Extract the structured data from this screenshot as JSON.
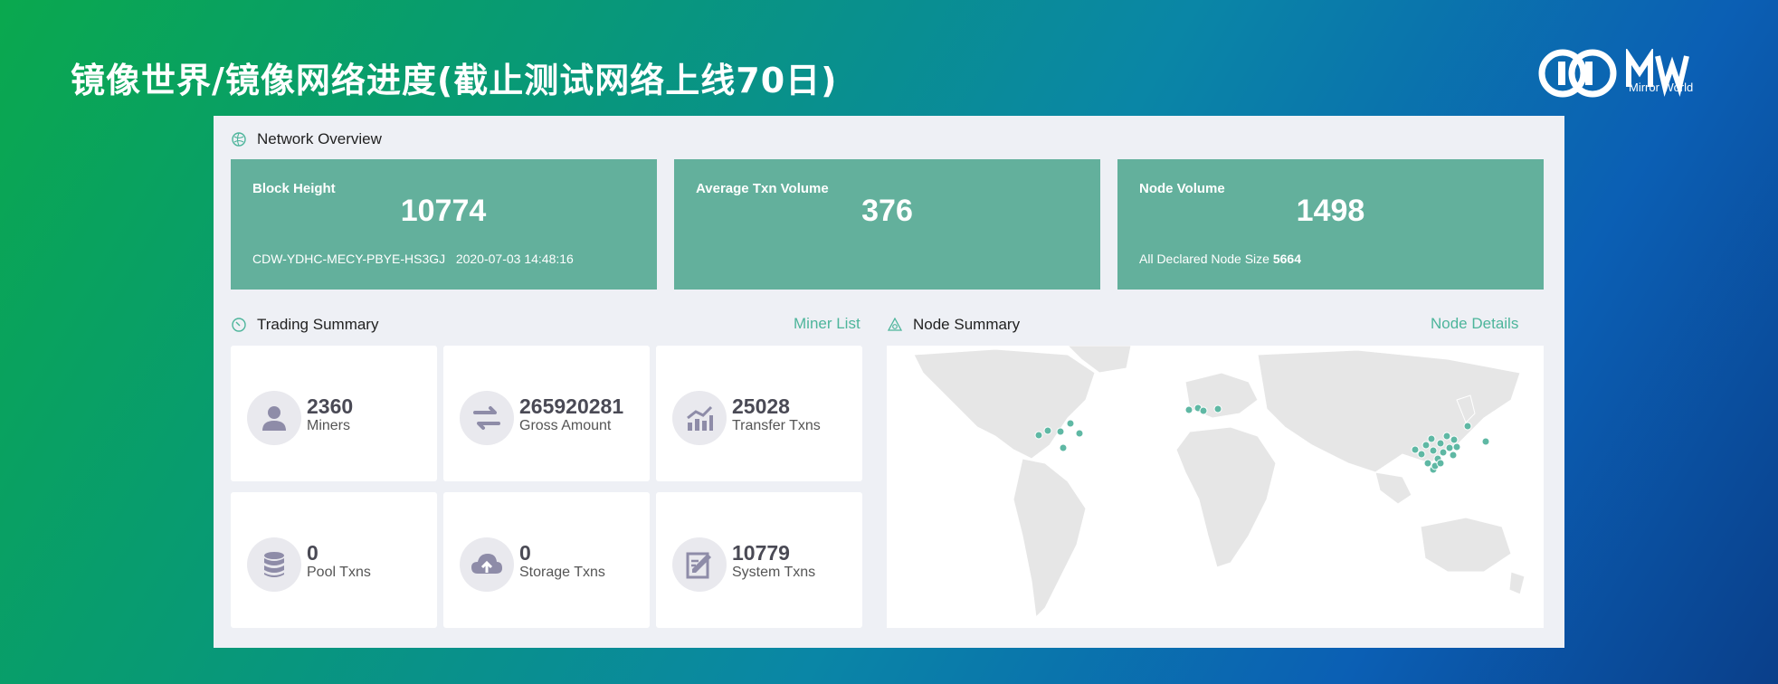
{
  "slide": {
    "title": "镜像世界/镜像网络进度(截止测试网络上线70日)"
  },
  "logo": {
    "text": "Mirror World"
  },
  "network": {
    "title": "Network Overview",
    "cards": [
      {
        "label": "Block Height",
        "value": "10774",
        "hash": "CDW-YDHC-MECY-PBYE-HS3GJ",
        "time": "2020-07-03 14:48:16"
      },
      {
        "label": "Average Txn Volume",
        "value": "376"
      },
      {
        "label": "Node Volume",
        "value": "1498",
        "declared_label": "All Declared Node Size",
        "declared_value": "5664"
      }
    ]
  },
  "trading": {
    "title": "Trading Summary",
    "link": "Miner List",
    "tiles": [
      {
        "value": "2360",
        "label": "Miners",
        "icon": "user-icon"
      },
      {
        "value": "265920281",
        "label": "Gross Amount",
        "icon": "swap-arrows-icon"
      },
      {
        "value": "25028",
        "label": "Transfer Txns",
        "icon": "trend-chart-icon"
      },
      {
        "value": "0",
        "label": "Pool Txns",
        "icon": "database-icon"
      },
      {
        "value": "0",
        "label": "Storage Txns",
        "icon": "cloud-upload-icon"
      },
      {
        "value": "10779",
        "label": "System Txns",
        "icon": "edit-document-icon"
      }
    ]
  },
  "nodes": {
    "title": "Node Summary",
    "link": "Node Details"
  },
  "colors": {
    "accent": "#4db59b",
    "card": "#63b09c",
    "icon": "#8e8ca8"
  }
}
